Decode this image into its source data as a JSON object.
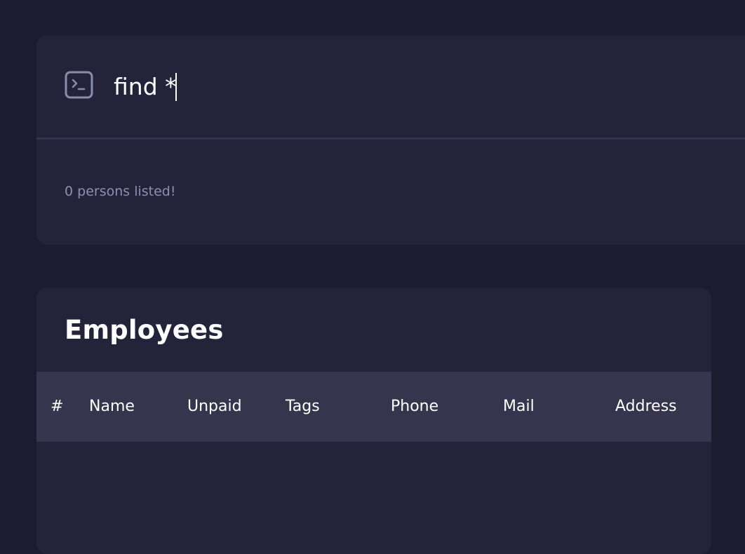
{
  "command": {
    "input_value": "find *",
    "icon": "terminal-icon",
    "result_message": "0 persons listed!"
  },
  "employees": {
    "title": "Employees",
    "columns": [
      "#",
      "Name",
      "Unpaid",
      "Tags",
      "Phone",
      "Mail",
      "Address"
    ],
    "rows": []
  },
  "colors": {
    "background": "#1b1c2f",
    "card": "#23243a",
    "table_header": "#35364e",
    "muted_text": "#8e8fb0",
    "icon_stroke": "#8a8cab"
  }
}
